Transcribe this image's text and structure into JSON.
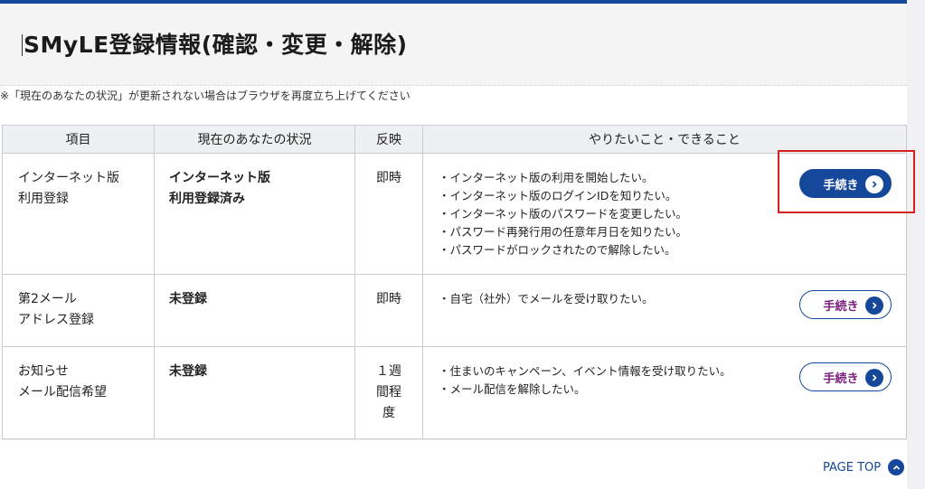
{
  "page": {
    "title": "SMyLE登録情報(確認・変更・解除)",
    "notice": "※「現在のあなたの状況」が更新されない場合はブラウザを再度立ち上げてください",
    "page_top_label": "PAGE TOP"
  },
  "table": {
    "headers": [
      "項目",
      "現在のあなたの状況",
      "反映",
      "やりたいこと・できること"
    ],
    "rows": [
      {
        "item": [
          "インターネット版",
          "利用登録"
        ],
        "status": [
          "インターネット版",
          "利用登録済み"
        ],
        "reflect": [
          "即時"
        ],
        "todo": [
          "インターネット版の利用を開始したい。",
          "インターネット版のログインIDを知りたい。",
          "インターネット版のパスワードを変更したい。",
          "パスワード再発行用の任意年月日を知りたい。",
          "パスワードがロックされたので解除したい。"
        ],
        "button": "手続き"
      },
      {
        "item": [
          "第2メール",
          "アドレス登録"
        ],
        "status": [
          "未登録"
        ],
        "reflect": [
          "即時"
        ],
        "todo": [
          "自宅（社外）でメールを受け取りたい。"
        ],
        "button": "手続き"
      },
      {
        "item": [
          "お知らせ",
          "メール配信希望"
        ],
        "status": [
          "未登録"
        ],
        "reflect": [
          "１週",
          "間程",
          "度"
        ],
        "todo": [
          "住まいのキャンペーン、イベント情報を受け取りたい。",
          "メール配信を解除したい。"
        ],
        "button": "手続き"
      }
    ]
  },
  "colors": {
    "brand": "#15479a",
    "highlight": "#d42020",
    "secondary_text": "#7a1e7d"
  },
  "icons": {
    "button_chevron": "chevron-right-icon",
    "page_top": "chevron-up-icon"
  }
}
